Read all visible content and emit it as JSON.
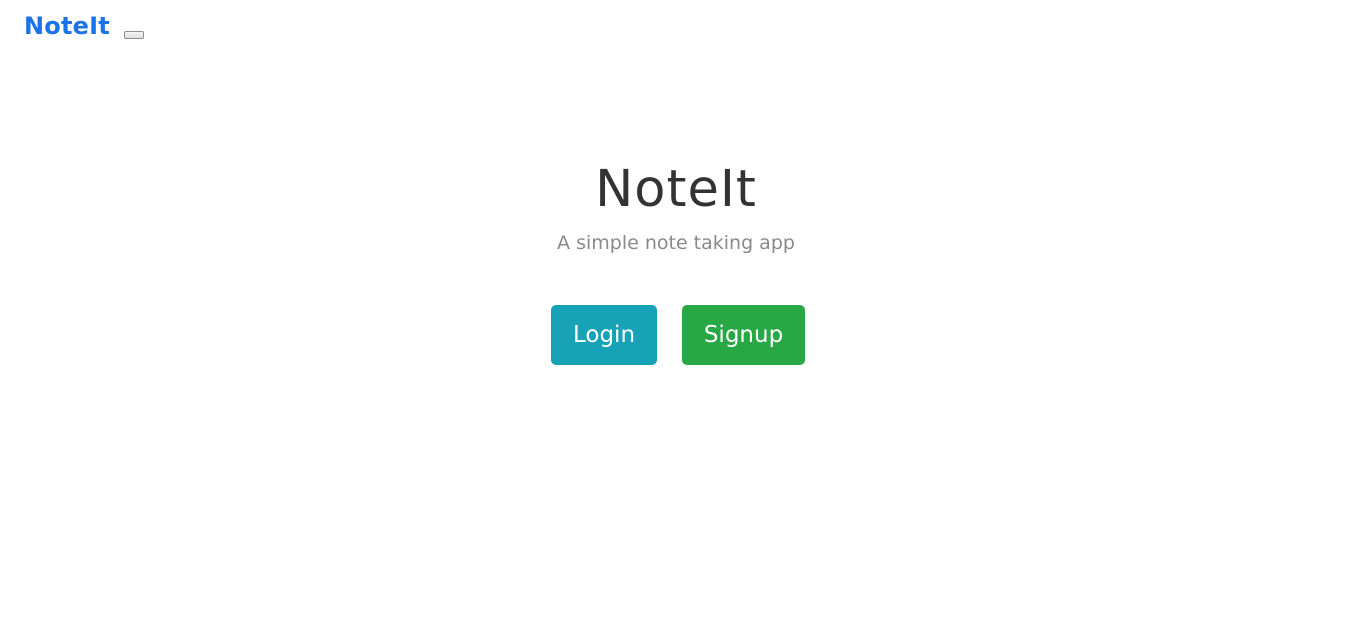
{
  "navbar": {
    "brand": "NoteIt"
  },
  "hero": {
    "title": "NoteIt",
    "subtitle": "A simple note taking app"
  },
  "actions": {
    "login_label": "Login",
    "signup_label": "Signup"
  },
  "colors": {
    "brand": "#1a73e8",
    "login": "#17a2b8",
    "signup": "#28a745",
    "title": "#333333",
    "subtitle": "#8a8a8a"
  }
}
